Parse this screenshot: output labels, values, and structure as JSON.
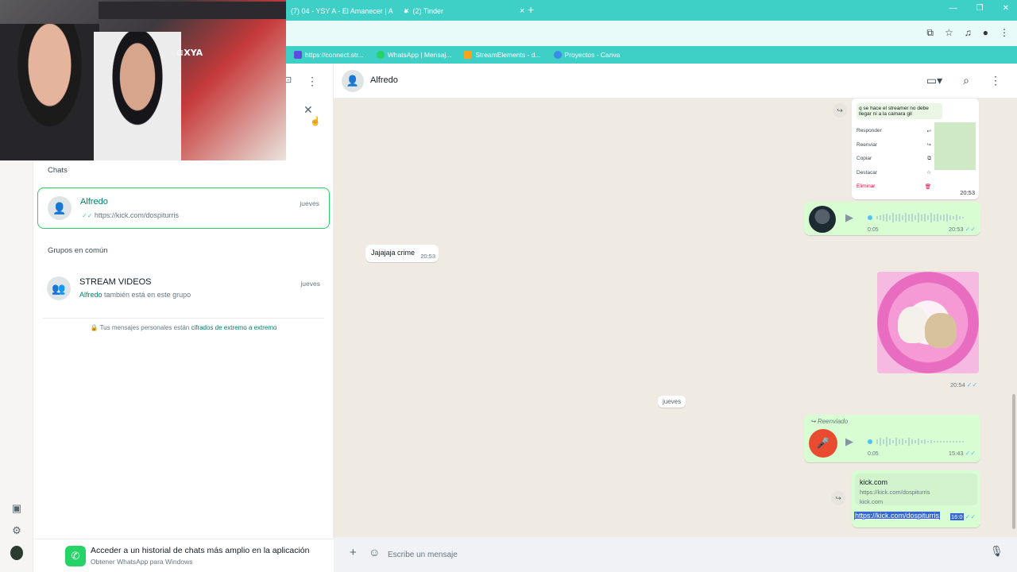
{
  "browser": {
    "tabs": [
      {
        "label": "(7) 04 - YSY A - El Amanecer | A"
      },
      {
        "label": "(2) Tinder"
      }
    ],
    "new_tab": "+",
    "bookmarks": [
      {
        "label": "https://connect.str...",
        "color": "#5b4ee0"
      },
      {
        "label": "WhatsApp | Mensaj...",
        "color": "#25d366"
      },
      {
        "label": "StreamElements - d...",
        "color": "#f8a31a"
      },
      {
        "label": "Proyectos - Canva",
        "color": "#3b8be8"
      }
    ]
  },
  "contact_info": {
    "chats_title": "Chats",
    "chat_item": {
      "name": "Alfredo",
      "preview": "https://kick.com/dospiturris",
      "date": "jueves"
    },
    "groups_title": "Grupos en común",
    "group_item": {
      "name": "STREAM VIDEOS",
      "sub_highlight": "Alfredo",
      "sub_rest": " también está en este grupo",
      "date": "jueves"
    },
    "e2e_text": "Tus mensajes personales están ",
    "e2e_link": "cifrados de extremo a extremo",
    "promo_title": "Acceder a un historial de chats más amplio en la aplicación",
    "promo_sub": "Obtener WhatsApp para Windows"
  },
  "conversation": {
    "contact_name": "Alfredo",
    "screenshot_msg": {
      "quote": "q se hace el streamer no debe llegar ni a la camara gil",
      "menu": [
        "Responder",
        "Reenviar",
        "Copiar",
        "Destacar",
        "Eliminar"
      ],
      "time": "20:53"
    },
    "voice1": {
      "duration": "0:05",
      "time": "20:53"
    },
    "incoming": {
      "text": "Jajajaja crime",
      "time": "20:53"
    },
    "sticker_time": "20:54",
    "date_chip": "jueves",
    "voice2": {
      "forwarded_label": "Reenviado",
      "duration": "0:05",
      "time": "15:43"
    },
    "link_msg": {
      "preview_title": "kick.com",
      "preview_url": "https://kick.com/dospiturris",
      "preview_domain": "kick.com",
      "url": "https://kick.com/dospiturris",
      "time": "16:0"
    },
    "composer_placeholder": "Escribe un mensaje"
  }
}
